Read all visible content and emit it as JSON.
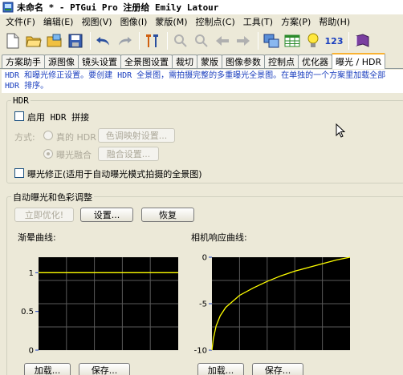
{
  "window": {
    "title": "未命名 * - PTGui Pro 注册给 Emily Latour"
  },
  "menu": [
    "文件(F)",
    "编辑(E)",
    "视图(V)",
    "图像(I)",
    "蒙版(M)",
    "控制点(C)",
    "工具(T)",
    "方案(P)",
    "帮助(H)"
  ],
  "toolbar": {
    "icons": [
      "new-document-icon",
      "open-folder-icon",
      "open-images-icon",
      "save-icon",
      "undo-icon",
      "redo-icon",
      "optimize-icon",
      "zoom-in-icon",
      "zoom-out-icon",
      "back-arrow-icon",
      "forward-arrow-icon",
      "panorama-editor-icon",
      "table-icon",
      "lightbulb-icon",
      "numbering-icon",
      "book-icon"
    ],
    "number_label": "123"
  },
  "tabs": [
    "方案助手",
    "源图像",
    "镜头设置",
    "全景图设置",
    "裁切",
    "蒙版",
    "图像参数",
    "控制点",
    "优化器",
    "曝光 / HDR"
  ],
  "active_tab": "曝光 / HDR",
  "info_text": "HDR 和曝光修正设置。要创建 HDR 全景图，需拍摄完整的多重曝光全景图。在单独的一个方案里加载全部 HDR 排序。",
  "hdr": {
    "group_label": "HDR",
    "enable_label": "启用 HDR 拼接",
    "method_label": "方式:",
    "true_hdr_label": "真的 HDR",
    "tone_map_button": "色调映射设置...",
    "exposure_fusion_label": "曝光融合",
    "fusion_button": "融合设置...",
    "exposure_correction_label": "曝光修正(适用于自动曝光模式拍摄的全景图)"
  },
  "auto_exposure": {
    "group_label": "自动曝光和色彩调整",
    "optimize_now_button": "立即优化!",
    "settings_button": "设置...",
    "restore_button": "恢复",
    "vignetting_label": "渐晕曲线:",
    "response_label": "相机响应曲线:",
    "load_button": "加载...",
    "save_button": "保存..."
  },
  "chart_data": [
    {
      "type": "line",
      "title": "渐晕曲线:",
      "x": [
        0,
        0.1,
        0.2,
        0.3,
        0.4,
        0.5,
        0.6,
        0.7,
        0.8,
        0.9,
        1.0
      ],
      "series": [
        {
          "values": [
            1,
            1,
            1,
            1,
            1,
            1,
            1,
            1,
            1,
            1,
            1
          ]
        }
      ],
      "ylim": [
        0,
        1.2
      ],
      "yticks": [
        "1",
        "0.5",
        "0"
      ],
      "grid": true,
      "line_color": "#ffff00"
    },
    {
      "type": "line",
      "title": "相机响应曲线:",
      "x": [
        0,
        0.01,
        0.03,
        0.06,
        0.1,
        0.2,
        0.3,
        0.4,
        0.5,
        0.6,
        0.7,
        0.8,
        0.9,
        1.0
      ],
      "series": [
        {
          "values": [
            -10,
            -8.8,
            -7.4,
            -6.3,
            -5.4,
            -4.1,
            -3.3,
            -2.6,
            -2.0,
            -1.5,
            -1.1,
            -0.7,
            -0.3,
            0
          ]
        }
      ],
      "ylim": [
        -10,
        0
      ],
      "yticks": [
        "0",
        "-5",
        "-10"
      ],
      "grid": true,
      "line_color": "#ffff00"
    }
  ]
}
